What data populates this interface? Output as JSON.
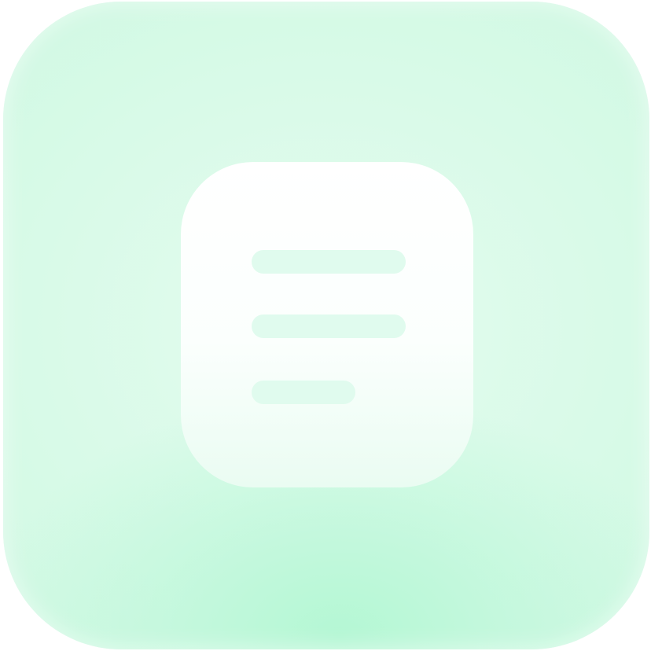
{
  "icon": {
    "name": "notes-app-icon",
    "glyph": "document-lines-icon",
    "colors": {
      "background_light": "#e4fcef",
      "background_mint": "#b4f7d4",
      "card": "#ffffff",
      "lines": "#e0fbee"
    },
    "line_count": 3
  }
}
